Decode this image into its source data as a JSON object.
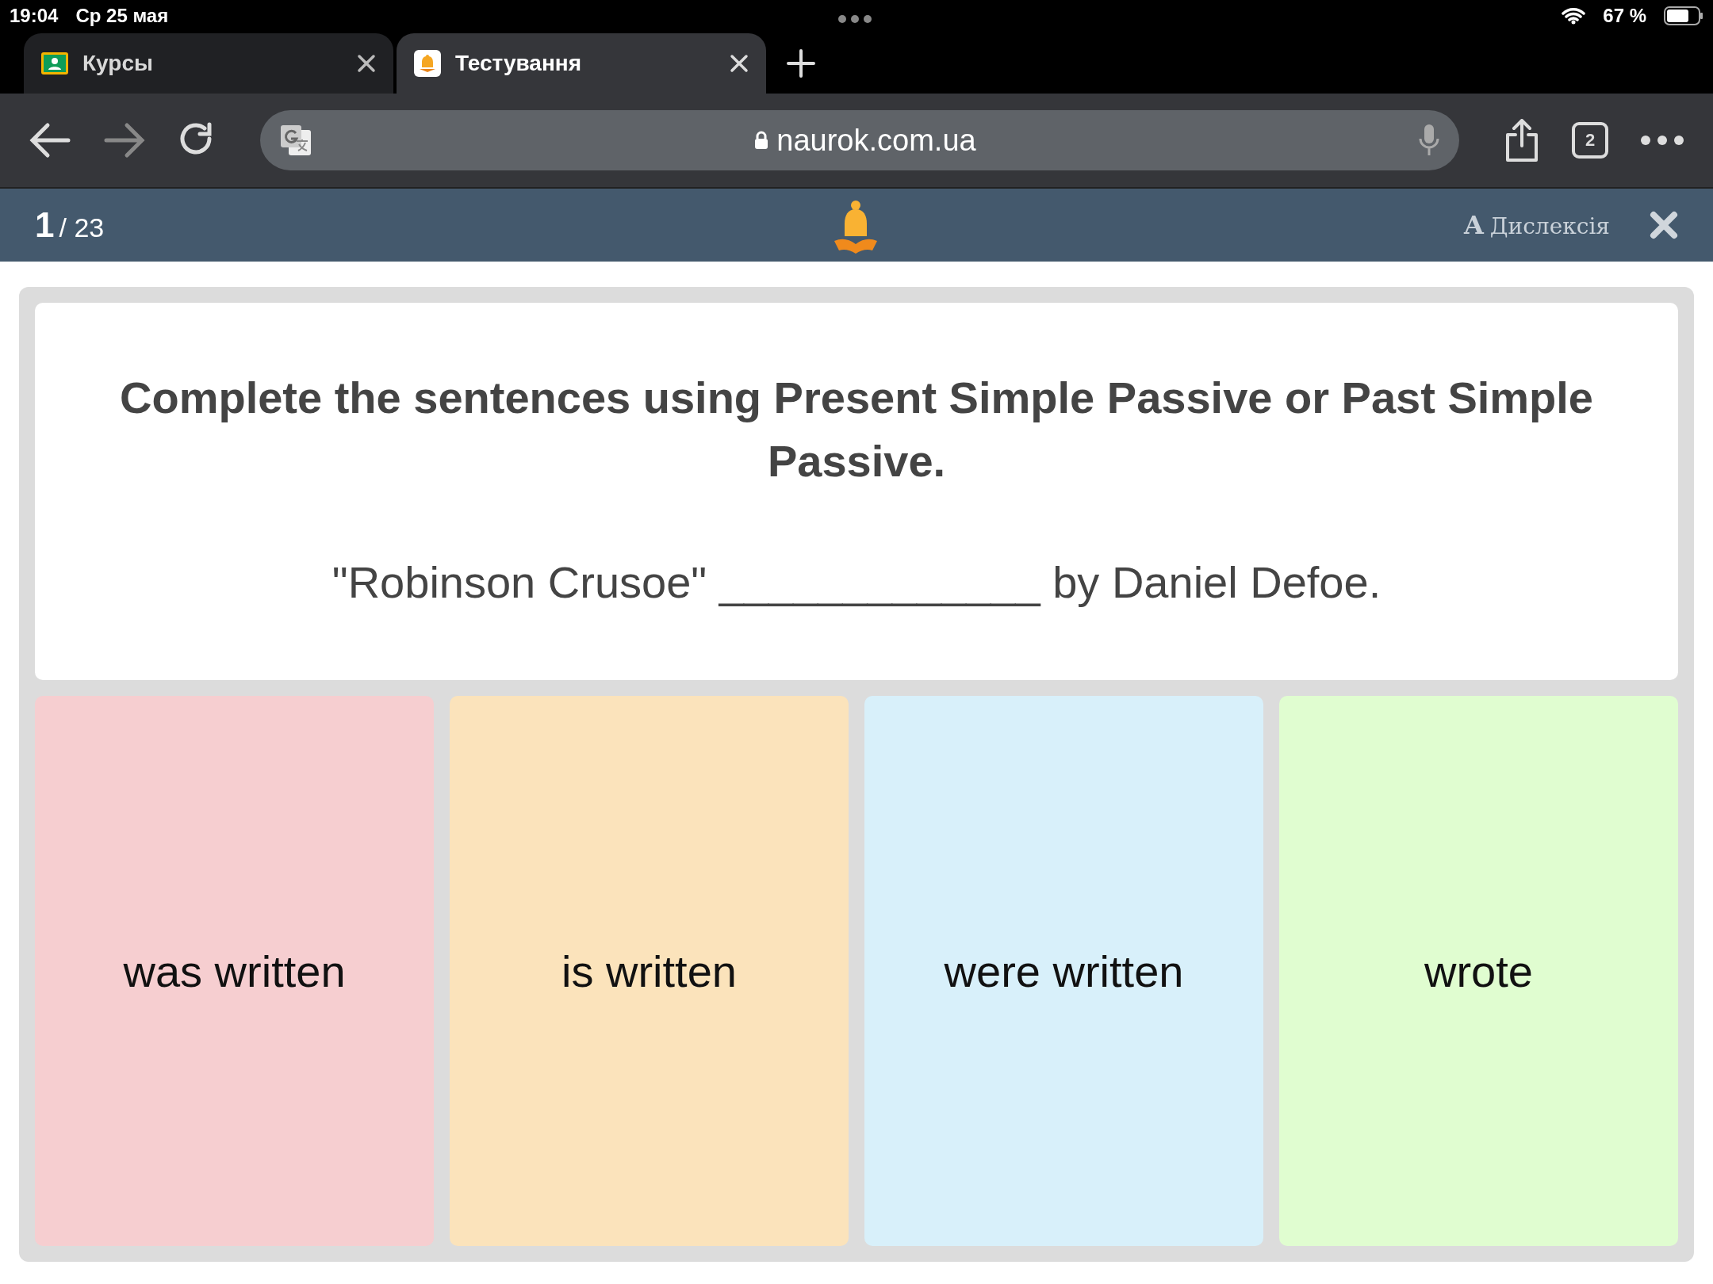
{
  "status_bar": {
    "time": "19:04",
    "date": "Ср 25 мая",
    "battery": "67 %"
  },
  "tabs": [
    {
      "title": "Курсы",
      "kind": "classroom",
      "selected": false
    },
    {
      "title": "Тестування",
      "kind": "bell",
      "selected": true
    }
  ],
  "toolbar": {
    "url": "naurok.com.ua",
    "tab_count": "2"
  },
  "quiz_header": {
    "current": "1",
    "total": "/ 23",
    "dyslexia_letter": "A",
    "dyslexia_label": "Дислексія"
  },
  "question": {
    "instruction": "Complete the sentences using Present Simple Passive or Past Simple Passive.",
    "sentence": "\"Robinson Crusoe\" _____________ by Daniel Defoe."
  },
  "answers": [
    {
      "text": "was written",
      "color": "#f6ced0"
    },
    {
      "text": "is written",
      "color": "#fbe3bb"
    },
    {
      "text": "were written",
      "color": "#d8f0fa"
    },
    {
      "text": "wrote",
      "color": "#e0fdd0"
    }
  ]
}
